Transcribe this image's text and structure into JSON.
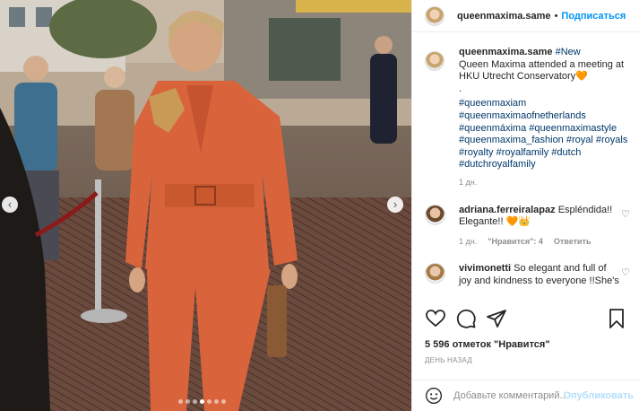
{
  "header": {
    "username": "queenmaxima.same",
    "separator": "•",
    "follow_label": "Подписаться"
  },
  "caption": {
    "username": "queenmaxima.same",
    "first_tag": "#New",
    "text_line1": "Queen Maxima attended a meeting at",
    "text_line2": "HKU Utrecht Conservatory",
    "heart_emoji": "🧡",
    "period": ".",
    "hashtags": [
      "#queenmaxiam",
      "#queenmaximaofnetherlands",
      "#queenmáxima #queenmaximastyle",
      "#queenmaxima_fashion #royal #royals",
      "#royalty #royalfamily #dutch",
      "#dutchroyalfamily"
    ],
    "time": "1 дн."
  },
  "comments": [
    {
      "username": "adriana.ferreiralapaz",
      "text_a": "Espléndida!!",
      "text_b": "Elegante!!",
      "emojis": "🧡👑",
      "time": "1 дн.",
      "likes": "\"Нравится\": 4",
      "reply": "Ответить"
    },
    {
      "username": "vivimonetti",
      "text_a": "So elegant and full of",
      "text_b": "joy and kindness to everyone !!She's"
    }
  ],
  "likes_text": "5 596 отметок \"Нравится\"",
  "date_text": "ДЕНЬ НАЗАД",
  "comment_box": {
    "placeholder": "Добавьте комментарий...",
    "publish_label": "Опубликовать"
  },
  "carousel": {
    "prev": "‹",
    "next": "›",
    "slides": 7,
    "active_index": 3
  },
  "colors": {
    "link": "#00376b",
    "follow": "#0095f6",
    "publish_disabled": "#b2dffc",
    "secondary": "#8e8e8e",
    "suit": "#d9643c"
  },
  "icons": [
    "heart-icon",
    "comment-icon",
    "share-icon",
    "bookmark-icon",
    "emoji-icon",
    "chevron-left-icon",
    "chevron-right-icon"
  ]
}
